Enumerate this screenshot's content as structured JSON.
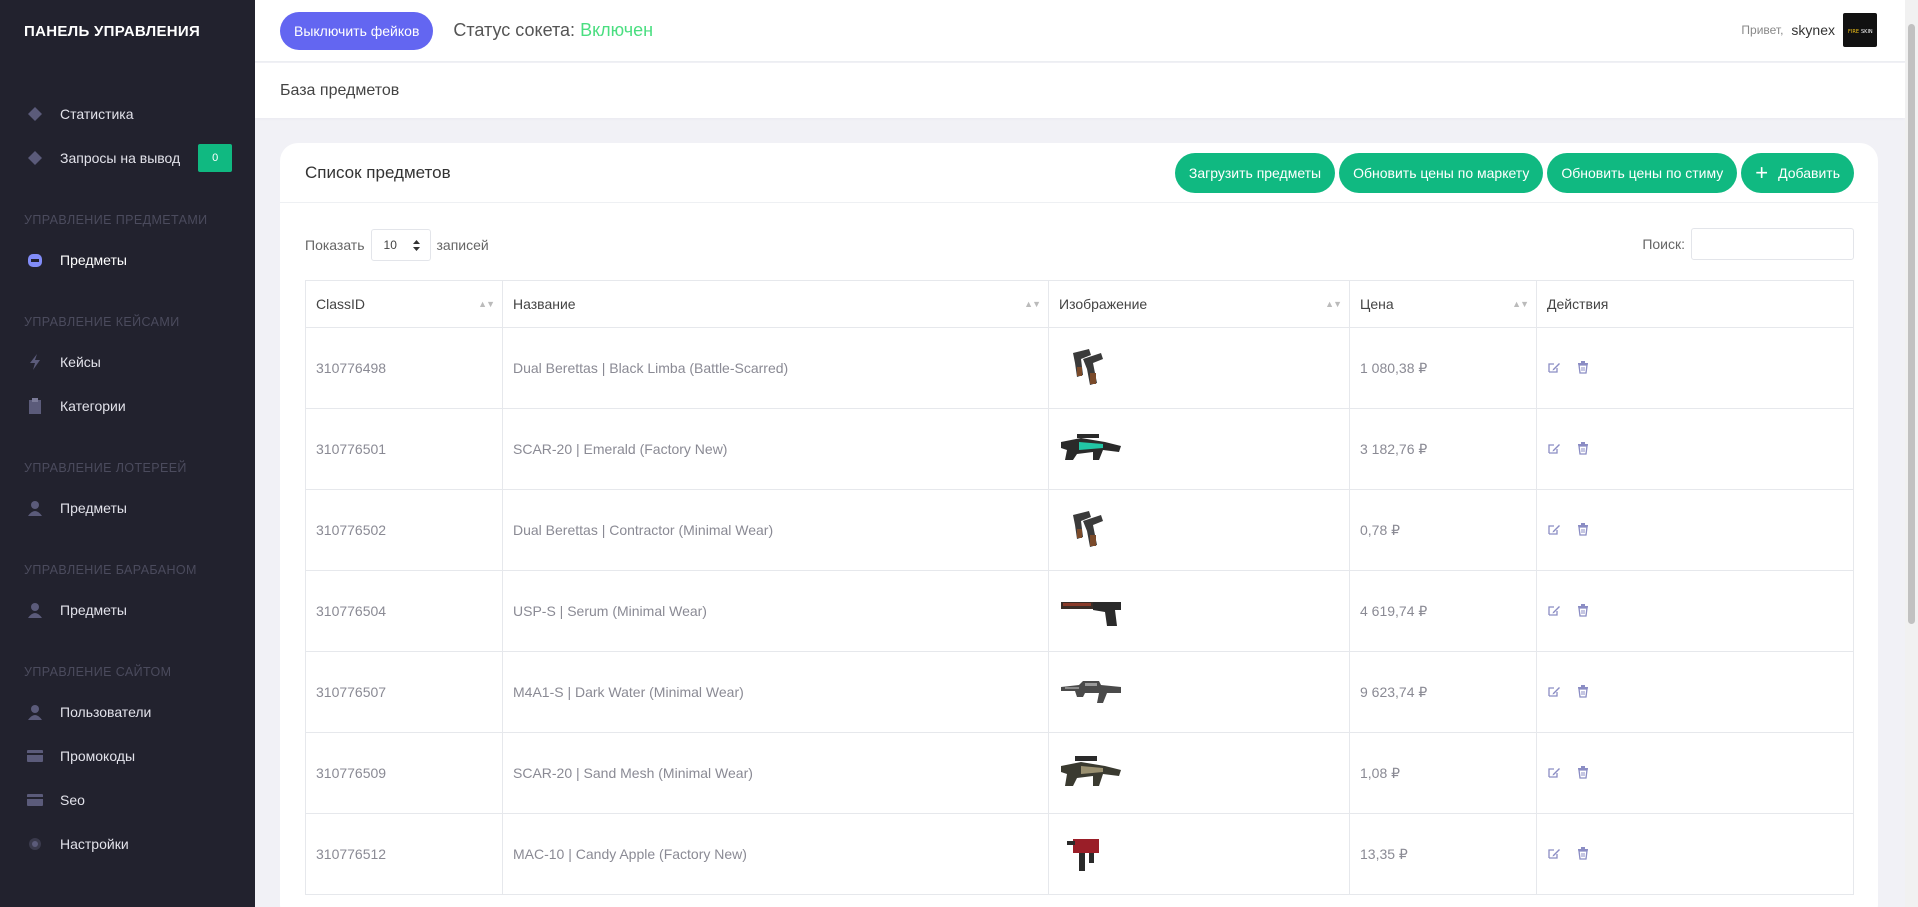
{
  "sidebar": {
    "brand": "ПАНЕЛЬ УПРАВЛЕНИЯ",
    "items_top": [
      {
        "label": "Статистика",
        "icon": "diamond-icon"
      },
      {
        "label": "Запросы на вывод",
        "icon": "diamond-icon",
        "badge": "0"
      }
    ],
    "sections": [
      {
        "title": "УПРАВЛЕНИЕ ПРЕДМЕТАМИ",
        "items": [
          {
            "label": "Предметы",
            "icon": "helmet-icon",
            "active": true
          }
        ]
      },
      {
        "title": "УПРАВЛЕНИЕ КЕЙСАМИ",
        "items": [
          {
            "label": "Кейсы",
            "icon": "bolt-icon"
          },
          {
            "label": "Категории",
            "icon": "clipboard-icon"
          }
        ]
      },
      {
        "title": "УПРАВЛЕНИЕ ЛОТЕРЕЕЙ",
        "items": [
          {
            "label": "Предметы",
            "icon": "user-icon"
          }
        ]
      },
      {
        "title": "УПРАВЛЕНИЕ БАРАБАНОМ",
        "items": [
          {
            "label": "Предметы",
            "icon": "user-icon"
          }
        ]
      },
      {
        "title": "УПРАВЛЕНИЕ САЙТОМ",
        "items": [
          {
            "label": "Пользователи",
            "icon": "user-icon"
          },
          {
            "label": "Промокоды",
            "icon": "card-icon"
          },
          {
            "label": "Seo",
            "icon": "card-icon"
          },
          {
            "label": "Настройки",
            "icon": "gear-icon"
          }
        ]
      }
    ]
  },
  "topbar": {
    "fakes_button": "Выключить фейков",
    "socket_label": "Статус сокета:",
    "socket_value": "Включен",
    "greeting": "Привет,",
    "username": "skynex"
  },
  "breadcrumb": "База предметов",
  "card": {
    "title": "Список предметов",
    "buttons": {
      "load": "Загрузить предметы",
      "market": "Обновить цены по маркету",
      "steam": "Обновить цены по стиму",
      "add": "Добавить"
    },
    "show_label": "Показать",
    "show_value": "10",
    "records_label": "записей",
    "search_label": "Поиск:"
  },
  "table": {
    "headers": [
      "ClassID",
      "Название",
      "Изображение",
      "Цена",
      "Действия"
    ],
    "rows": [
      {
        "id": "310776498",
        "name": "Dual Berettas | Black Limba (Battle-Scarred)",
        "price": "1 080,38 ₽",
        "img": "dual-pistols"
      },
      {
        "id": "310776501",
        "name": "SCAR-20 | Emerald (Factory New)",
        "price": "3 182,76 ₽",
        "img": "rifle-green"
      },
      {
        "id": "310776502",
        "name": "Dual Berettas | Contractor (Minimal Wear)",
        "price": "0,78 ₽",
        "img": "dual-pistols"
      },
      {
        "id": "310776504",
        "name": "USP-S | Serum (Minimal Wear)",
        "price": "4 619,74 ₽",
        "img": "pistol-silenced"
      },
      {
        "id": "310776507",
        "name": "M4A1-S | Dark Water (Minimal Wear)",
        "price": "9 623,74 ₽",
        "img": "rifle-grey"
      },
      {
        "id": "310776509",
        "name": "SCAR-20 | Sand Mesh (Minimal Wear)",
        "price": "1,08 ₽",
        "img": "rifle-sand"
      },
      {
        "id": "310776512",
        "name": "MAC-10 | Candy Apple (Factory New)",
        "price": "13,35 ₽",
        "img": "smg-red"
      }
    ]
  },
  "colors": {
    "sidebar": "#22222e",
    "accent": "#6366f1",
    "green": "#10b981",
    "socket_on": "#4ade80"
  }
}
